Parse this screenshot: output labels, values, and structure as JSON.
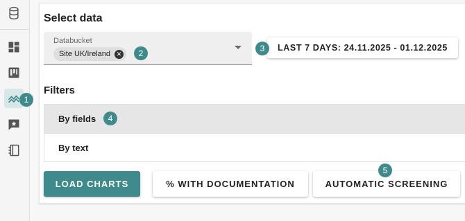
{
  "sidebar": {
    "items": [
      {
        "icon": "database-icon"
      },
      {
        "icon": "dashboard-icon"
      },
      {
        "icon": "kanban-icon"
      },
      {
        "icon": "chart-line-icon",
        "active": true
      },
      {
        "icon": "feedback-icon"
      },
      {
        "icon": "notebook-icon"
      }
    ]
  },
  "badges": [
    "1",
    "2",
    "3",
    "4",
    "5"
  ],
  "select_data": {
    "title": "Select data",
    "databucket_label": "Databucket",
    "chip_value": "Site UK/Ireland",
    "date_range": "LAST 7 DAYS: 24.11.2025 - 01.12.2025"
  },
  "filters": {
    "title": "Filters",
    "rows": [
      "By fields",
      "By text"
    ]
  },
  "buttons": {
    "load": "LOAD CHARTS",
    "documentation": "% WITH DOCUMENTATION",
    "screening": "AUTOMATIC SCREENING"
  },
  "colors": {
    "accent": "#3f8a8a",
    "active_bg": "#d8e8e8"
  }
}
